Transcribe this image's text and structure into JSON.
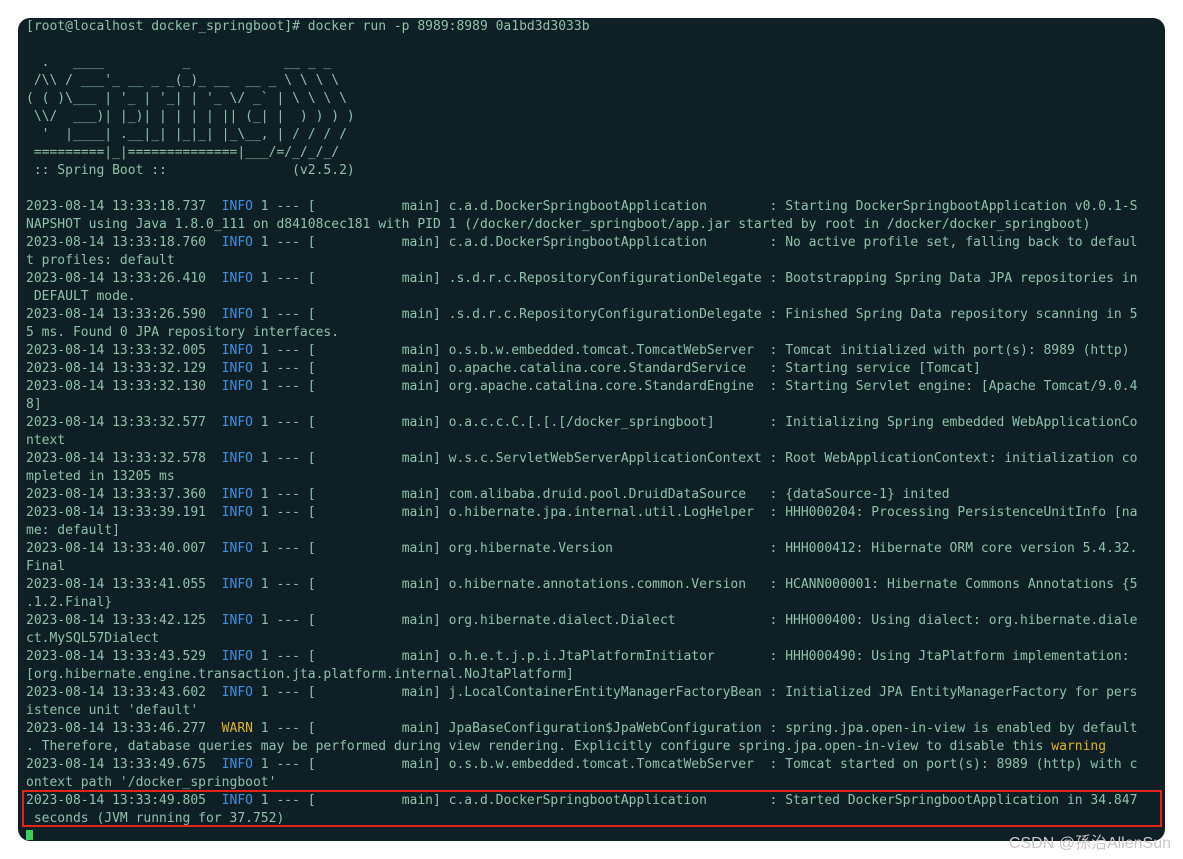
{
  "terminal": {
    "prompt": "[root@localhost docker_springboot]# docker run -p 8989:8989 0a1bd3d3033b",
    "banner": [
      "  .   ____          _            __ _ _",
      " /\\\\ / ___'_ __ _ _(_)_ __  __ _ \\ \\ \\ \\",
      "( ( )\\___ | '_ | '_| | '_ \\/ _` | \\ \\ \\ \\",
      " \\\\/  ___)| |_)| | | | | || (_| |  ) ) ) )",
      "  '  |____| .__|_| |_|_| |_\\__, | / / / /",
      " =========|_|==============|___/=/_/_/_/",
      " :: Spring Boot ::                (v2.5.2)"
    ],
    "logs": [
      {
        "ts": "2023-08-14 13:33:18.737",
        "level": "INFO",
        "mid": " 1 --- [           main] c.a.d.DockerSpringbootApplication        : Starting DockerSpringbootApplication v0.0.1-S",
        "cont": "NAPSHOT using Java 1.8.0_111 on d84108cec181 with PID 1 (/docker/docker_springboot/app.jar started by root in /docker/docker_springboot)"
      },
      {
        "ts": "2023-08-14 13:33:18.760",
        "level": "INFO",
        "mid": " 1 --- [           main] c.a.d.DockerSpringbootApplication        : No active profile set, falling back to defaul",
        "cont": "t profiles: default"
      },
      {
        "ts": "2023-08-14 13:33:26.410",
        "level": "INFO",
        "mid": " 1 --- [           main] .s.d.r.c.RepositoryConfigurationDelegate : Bootstrapping Spring Data JPA repositories in",
        "cont": " DEFAULT mode."
      },
      {
        "ts": "2023-08-14 13:33:26.590",
        "level": "INFO",
        "mid": " 1 --- [           main] .s.d.r.c.RepositoryConfigurationDelegate : Finished Spring Data repository scanning in 5",
        "cont": "5 ms. Found 0 JPA repository interfaces."
      },
      {
        "ts": "2023-08-14 13:33:32.005",
        "level": "INFO",
        "mid": " 1 --- [           main] o.s.b.w.embedded.tomcat.TomcatWebServer  : Tomcat initialized with port(s): 8989 (http)",
        "cont": ""
      },
      {
        "ts": "2023-08-14 13:33:32.129",
        "level": "INFO",
        "mid": " 1 --- [           main] o.apache.catalina.core.StandardService   : Starting service [Tomcat]",
        "cont": ""
      },
      {
        "ts": "2023-08-14 13:33:32.130",
        "level": "INFO",
        "mid": " 1 --- [           main] org.apache.catalina.core.StandardEngine  : Starting Servlet engine: [Apache Tomcat/9.0.4",
        "cont": "8]"
      },
      {
        "ts": "2023-08-14 13:33:32.577",
        "level": "INFO",
        "mid": " 1 --- [           main] o.a.c.c.C.[.[.[/docker_springboot]       : Initializing Spring embedded WebApplicationCo",
        "cont": "ntext"
      },
      {
        "ts": "2023-08-14 13:33:32.578",
        "level": "INFO",
        "mid": " 1 --- [           main] w.s.c.ServletWebServerApplicationContext : Root WebApplicationContext: initialization co",
        "cont": "mpleted in 13205 ms"
      },
      {
        "ts": "2023-08-14 13:33:37.360",
        "level": "INFO",
        "mid": " 1 --- [           main] com.alibaba.druid.pool.DruidDataSource   : {dataSource-1} inited",
        "cont": ""
      },
      {
        "ts": "2023-08-14 13:33:39.191",
        "level": "INFO",
        "mid": " 1 --- [           main] o.hibernate.jpa.internal.util.LogHelper  : HHH000204: Processing PersistenceUnitInfo [na",
        "cont": "me: default]"
      },
      {
        "ts": "2023-08-14 13:33:40.007",
        "level": "INFO",
        "mid": " 1 --- [           main] org.hibernate.Version                    : HHH000412: Hibernate ORM core version 5.4.32.",
        "cont": "Final"
      },
      {
        "ts": "2023-08-14 13:33:41.055",
        "level": "INFO",
        "mid": " 1 --- [           main] o.hibernate.annotations.common.Version   : HCANN000001: Hibernate Commons Annotations {5",
        "cont": ".1.2.Final}"
      },
      {
        "ts": "2023-08-14 13:33:42.125",
        "level": "INFO",
        "mid": " 1 --- [           main] org.hibernate.dialect.Dialect            : HHH000400: Using dialect: org.hibernate.diale",
        "cont": "ct.MySQL57Dialect"
      },
      {
        "ts": "2023-08-14 13:33:43.529",
        "level": "INFO",
        "mid": " 1 --- [           main] o.h.e.t.j.p.i.JtaPlatformInitiator       : HHH000490: Using JtaPlatform implementation: ",
        "cont": "[org.hibernate.engine.transaction.jta.platform.internal.NoJtaPlatform]"
      },
      {
        "ts": "2023-08-14 13:33:43.602",
        "level": "INFO",
        "mid": " 1 --- [           main] j.LocalContainerEntityManagerFactoryBean : Initialized JPA EntityManagerFactory for pers",
        "cont": "istence unit 'default'"
      },
      {
        "ts": "2023-08-14 13:33:46.277",
        "level": "WARN",
        "mid": " 1 --- [           main] JpaBaseConfiguration$JpaWebConfiguration : spring.jpa.open-in-view is enabled by default",
        "cont": ". Therefore, database queries may be performed during view rendering. Explicitly configure spring.jpa.open-in-view to disable this ",
        "contWarn": "warning"
      },
      {
        "ts": "2023-08-14 13:33:49.675",
        "level": "INFO",
        "mid": " 1 --- [           main] o.s.b.w.embedded.tomcat.TomcatWebServer  : Tomcat started on port(s): 8989 (http) with c",
        "cont": "ontext path '/docker_springboot'"
      },
      {
        "ts": "2023-08-14 13:33:49.805",
        "level": "INFO",
        "mid": " 1 --- [           main] c.a.d.DockerSpringbootApplication        : Started DockerSpringbootApplication in 34.847",
        "cont": " seconds (JVM running for 37.752)"
      }
    ]
  },
  "watermark": "CSDN @孫治AllenSun",
  "colors": {
    "background": "#0f1f26",
    "text": "#8ec2a8",
    "info": "#3d8fe0",
    "warn": "#e0b325",
    "highlight": "#e2231a",
    "cursor": "#3ccf5a"
  }
}
